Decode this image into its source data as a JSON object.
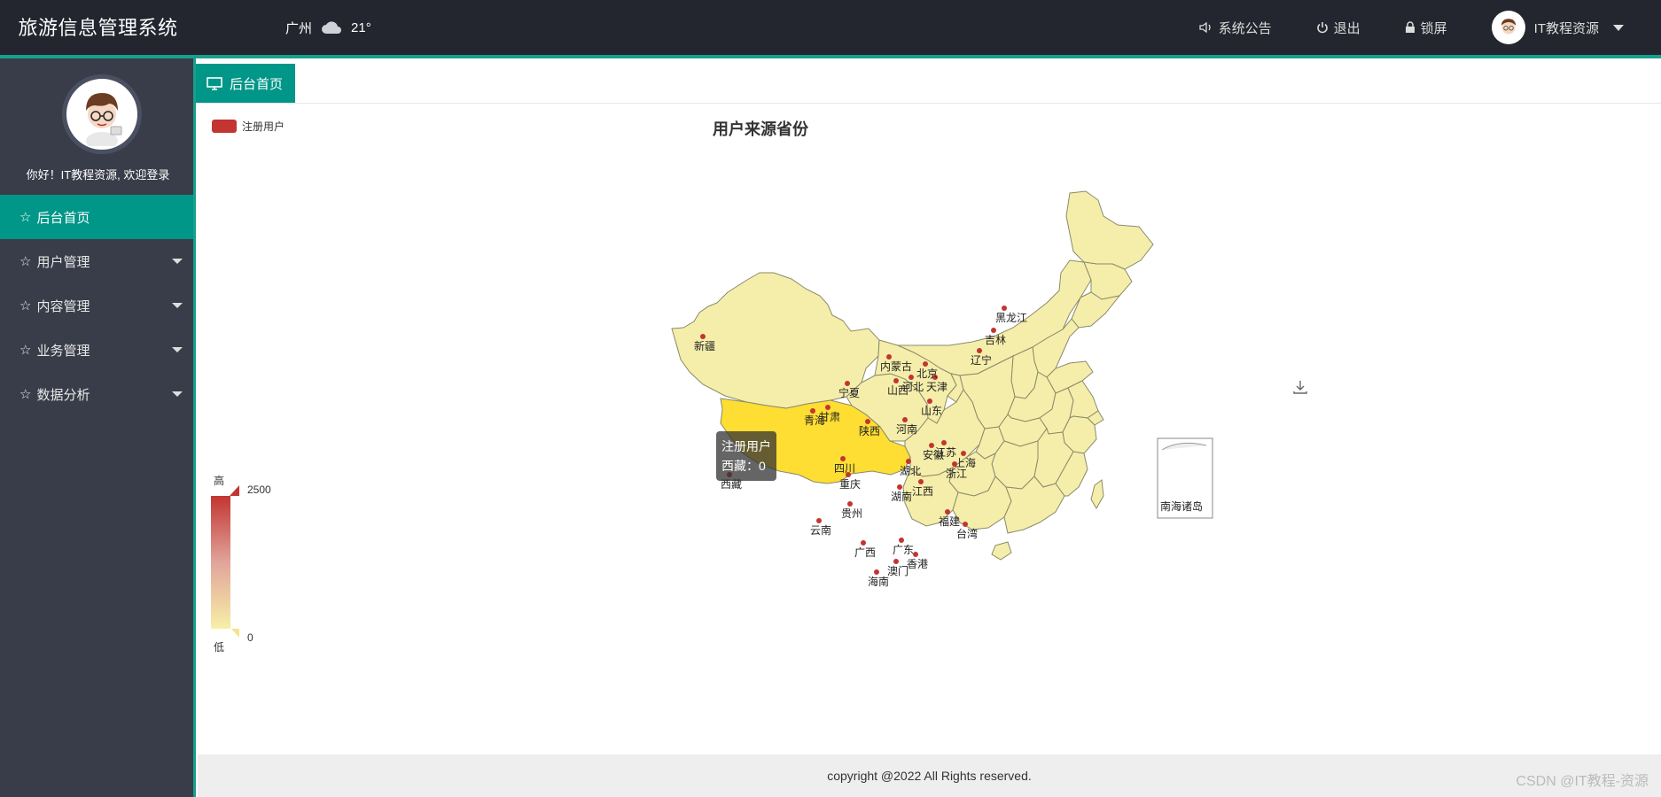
{
  "header": {
    "brand": "旅游信息管理系统",
    "weather_city": "广州",
    "weather_temp": "21°",
    "notice": "系统公告",
    "logout": "退出",
    "lock": "锁屏",
    "username": "IT教程资源"
  },
  "sidebar": {
    "welcome": "你好！IT教程资源, 欢迎登录",
    "items": [
      {
        "label": "后台首页"
      },
      {
        "label": "用户管理"
      },
      {
        "label": "内容管理"
      },
      {
        "label": "业务管理"
      },
      {
        "label": "数据分析"
      }
    ]
  },
  "tabs": [
    {
      "label": "后台首页"
    }
  ],
  "tooltip": {
    "series": "注册用户",
    "line": "西藏：0"
  },
  "footer": "copyright @2022 All Rights reserved.",
  "watermark": "CSDN @IT教程-资源",
  "colors": {
    "header_bg": "#23262e",
    "sidebar_bg": "#393d49",
    "accent": "#009688",
    "series": "#c23531",
    "highlight": "#ffde33"
  },
  "chart_data": {
    "type": "map",
    "title": "用户来源省份",
    "legend": [
      "注册用户"
    ],
    "visual_map": {
      "min": 0,
      "max": 2500,
      "high_label": "高",
      "low_label": "低"
    },
    "inset_label": "南海诸岛",
    "series": [
      {
        "name": "注册用户",
        "regions": [
          {
            "name": "新疆",
            "value": 0
          },
          {
            "name": "西藏",
            "value": 0,
            "highlighted": true
          },
          {
            "name": "青海",
            "value": 0
          },
          {
            "name": "甘肃",
            "value": 0
          },
          {
            "name": "宁夏",
            "value": 0
          },
          {
            "name": "内蒙古",
            "value": 0
          },
          {
            "name": "黑龙江",
            "value": 0
          },
          {
            "name": "吉林",
            "value": 0
          },
          {
            "name": "辽宁",
            "value": 0
          },
          {
            "name": "北京",
            "value": 0
          },
          {
            "name": "天津",
            "value": 0
          },
          {
            "name": "河北",
            "value": 0
          },
          {
            "name": "山西",
            "value": 0
          },
          {
            "name": "山东",
            "value": 0
          },
          {
            "name": "陕西",
            "value": 0
          },
          {
            "name": "河南",
            "value": 0
          },
          {
            "name": "四川",
            "value": 0
          },
          {
            "name": "重庆",
            "value": 0
          },
          {
            "name": "湖北",
            "value": 0
          },
          {
            "name": "安徽",
            "value": 0
          },
          {
            "name": "江苏",
            "value": 0
          },
          {
            "name": "上海",
            "value": 0
          },
          {
            "name": "浙江",
            "value": 0
          },
          {
            "name": "湖南",
            "value": 0
          },
          {
            "name": "江西",
            "value": 0
          },
          {
            "name": "贵州",
            "value": 0
          },
          {
            "name": "云南",
            "value": 0
          },
          {
            "name": "广西",
            "value": 0
          },
          {
            "name": "广东",
            "value": 0
          },
          {
            "name": "福建",
            "value": 0
          },
          {
            "name": "台湾",
            "value": 0
          },
          {
            "name": "香港",
            "value": 0
          },
          {
            "name": "澳门",
            "value": 0
          },
          {
            "name": "海南",
            "value": 0
          }
        ]
      }
    ]
  }
}
